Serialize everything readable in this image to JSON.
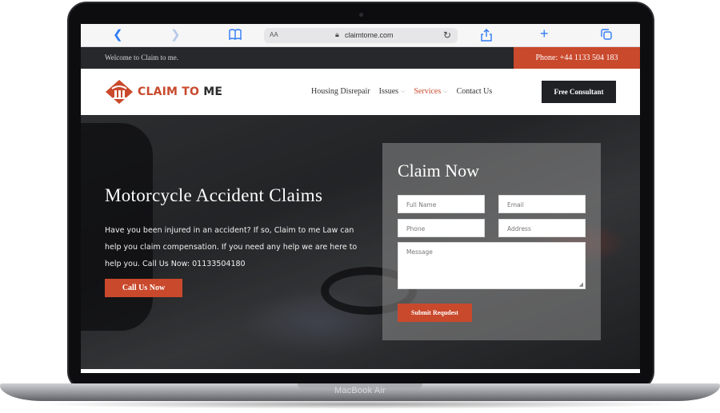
{
  "device": {
    "model_label": "MacBook Air"
  },
  "browser": {
    "text_size_label": "AA",
    "url": "claimtome.com"
  },
  "topbar": {
    "welcome": "Welcome to Claim to me.",
    "phone": "Phone: +44 1133 504 183"
  },
  "brand": {
    "name_part1": "CLAIM TO",
    "name_part2": "ME",
    "accent_color": "#c9492c",
    "dark_color": "#1f2124"
  },
  "nav": {
    "items": [
      {
        "label": "Housing Disrepair",
        "has_dropdown": false
      },
      {
        "label": "Issues",
        "has_dropdown": true
      },
      {
        "label": "Services",
        "has_dropdown": true,
        "active": true
      },
      {
        "label": "Contact Us",
        "has_dropdown": false
      }
    ],
    "cta_label": "Free Consultant"
  },
  "hero": {
    "title": "Motorcycle Accident Claims",
    "description": "Have you been injured in an accident? If so, Claim to me Law can help you claim compensation. If you need any help we are here to help you. Call Us Now: 01133504180",
    "button_label": "Call Us Now"
  },
  "form": {
    "title": "Claim Now",
    "fields": {
      "full_name": {
        "placeholder": "Full Name",
        "value": ""
      },
      "email": {
        "placeholder": "Email",
        "value": ""
      },
      "phone": {
        "placeholder": "Phone",
        "value": ""
      },
      "address": {
        "placeholder": "Address",
        "value": ""
      },
      "message": {
        "placeholder": "Message",
        "value": ""
      }
    },
    "submit_label": "Submit Requdest"
  },
  "icons": [
    "back-icon",
    "forward-icon",
    "bookmarks-icon",
    "lock-icon",
    "reload-icon",
    "share-icon",
    "new-tab-icon",
    "tabs-icon",
    "chevron-down-icon"
  ]
}
